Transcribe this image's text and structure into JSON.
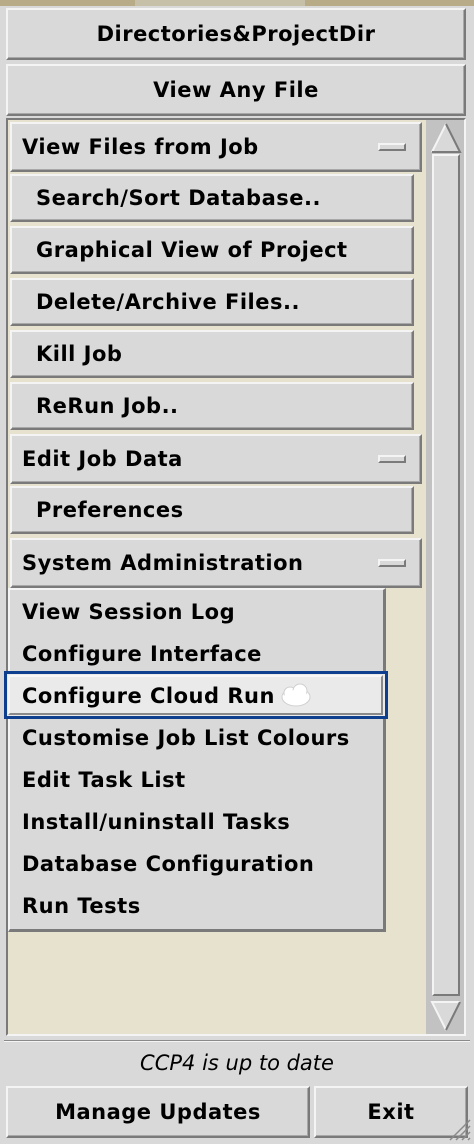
{
  "top_buttons": {
    "directories": "Directories&ProjectDir",
    "view_any_file": "View Any File"
  },
  "menu_rows": [
    {
      "label": "View Files from Job",
      "kind": "header"
    },
    {
      "label": "Search/Sort Database..",
      "kind": "button"
    },
    {
      "label": "Graphical View of Project",
      "kind": "button"
    },
    {
      "label": "Delete/Archive Files..",
      "kind": "button"
    },
    {
      "label": "Kill Job",
      "kind": "button"
    },
    {
      "label": "ReRun Job..",
      "kind": "button"
    },
    {
      "label": "Edit Job Data",
      "kind": "header"
    },
    {
      "label": "Preferences",
      "kind": "button"
    },
    {
      "label": "System Administration",
      "kind": "header"
    }
  ],
  "system_admin_menu": {
    "items": [
      "View Session Log",
      "Configure Interface",
      "Configure Cloud Run",
      "Customise Job List Colours",
      "Edit Task List",
      "Install/uninstall Tasks",
      "Database Configuration",
      "Run Tests"
    ],
    "highlighted_index": 2,
    "highlight_color": "#0d3f8e"
  },
  "status": {
    "text": "CCP4 is up to date"
  },
  "bottom_buttons": {
    "manage_updates": "Manage Updates",
    "exit": "Exit"
  },
  "colors": {
    "panel_bg": "#d9d9d9",
    "content_bg": "#e6e2ce",
    "scroll_trough": "#c2c2c2"
  }
}
